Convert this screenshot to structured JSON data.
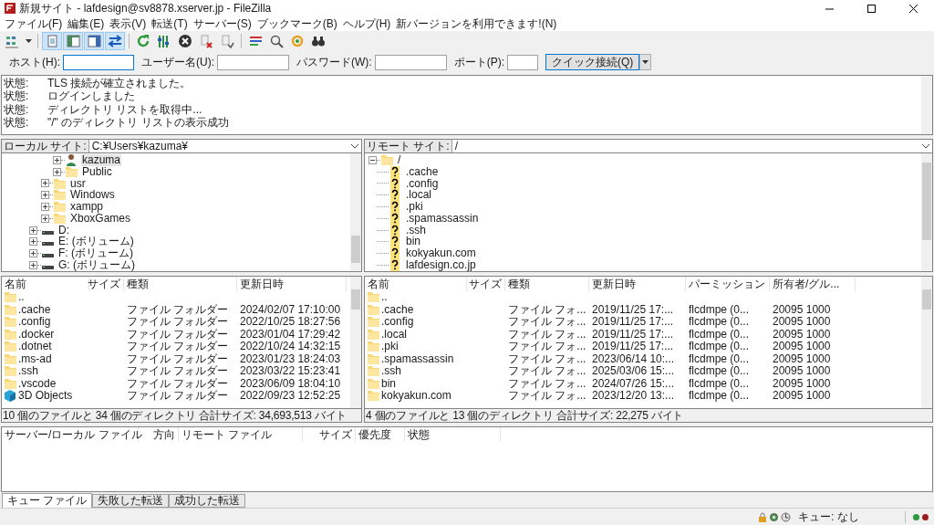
{
  "window": {
    "title": "新規サイト - lafdesign@sv8878.xserver.jp - FileZilla"
  },
  "menu": [
    "ファイル(F)",
    "編集(E)",
    "表示(V)",
    "転送(T)",
    "サーバー(S)",
    "ブックマーク(B)",
    "ヘルプ(H)",
    "新バージョンを利用できます!(N)"
  ],
  "toolbar": [
    {
      "kind": "sites",
      "pressed": false
    },
    {
      "kind": "caret",
      "pressed": false
    },
    {
      "kind": "sep"
    },
    {
      "kind": "log",
      "pressed": true
    },
    {
      "kind": "localtree",
      "pressed": true
    },
    {
      "kind": "remotetree",
      "pressed": true
    },
    {
      "kind": "queue",
      "pressed": true
    },
    {
      "kind": "sep"
    },
    {
      "kind": "refresh",
      "pressed": false
    },
    {
      "kind": "filter",
      "pressed": false
    },
    {
      "kind": "cancel",
      "pressed": false
    },
    {
      "kind": "disconnect",
      "pressed": false
    },
    {
      "kind": "reconnect",
      "pressed": false
    },
    {
      "kind": "sep"
    },
    {
      "kind": "compare",
      "pressed": false
    },
    {
      "kind": "search",
      "pressed": false
    },
    {
      "kind": "sync",
      "pressed": false
    },
    {
      "kind": "binoculars",
      "pressed": false
    }
  ],
  "quickconnect": {
    "host_label": "ホスト(H):",
    "user_label": "ユーザー名(U):",
    "password_label": "パスワード(W):",
    "port_label": "ポート(P):",
    "button": "クイック接続(Q)"
  },
  "log": [
    {
      "label": "状態:",
      "message": "TLS 接続が確立されました。"
    },
    {
      "label": "状態:",
      "message": "ログインしました"
    },
    {
      "label": "状態:",
      "message": "ディレクトリ リストを取得中..."
    },
    {
      "label": "状態:",
      "message": "\"/\" のディレクトリ リストの表示成功"
    }
  ],
  "local": {
    "site_label": "ローカル サイト:",
    "path": "C:¥Users¥kazuma¥",
    "tree": [
      {
        "children": [
          {
            "children": [
              {
                "label": "kazuma",
                "kind": "user",
                "expanded": false,
                "selected": true
              },
              {
                "label": "Public",
                "kind": "folder",
                "expanded": false,
                "selected": false
              }
            ]
          },
          {
            "label": "usr",
            "kind": "folder",
            "expanded": false,
            "selected": false
          },
          {
            "label": "Windows",
            "kind": "folder",
            "expanded": false,
            "selected": false
          },
          {
            "label": "xampp",
            "kind": "folder",
            "expanded": false,
            "selected": false
          },
          {
            "label": "XboxGames",
            "kind": "folder",
            "expanded": false,
            "selected": false
          }
        ]
      },
      {
        "label": "D:",
        "kind": "drive",
        "expanded": false,
        "selected": false
      },
      {
        "label": "E: (ボリューム)",
        "kind": "drive",
        "expanded": false,
        "selected": false
      },
      {
        "label": "F: (ボリューム)",
        "kind": "drive",
        "expanded": false,
        "selected": false
      },
      {
        "label": "G: (ボリューム)",
        "kind": "drive",
        "expanded": false,
        "selected": false
      }
    ],
    "columns": [
      "名前",
      "サイズ",
      "種類",
      "更新日時"
    ],
    "rows": [
      {
        "kind": "folder",
        "cells": [
          ".."
        ]
      },
      {
        "kind": "folder",
        "cells": [
          ".cache",
          "",
          "ファイル フォルダー",
          "2024/02/07 17:10:00"
        ]
      },
      {
        "kind": "folder",
        "cells": [
          ".config",
          "",
          "ファイル フォルダー",
          "2022/10/25 18:27:56"
        ]
      },
      {
        "kind": "folder",
        "cells": [
          ".docker",
          "",
          "ファイル フォルダー",
          "2023/01/04 17:29:42"
        ]
      },
      {
        "kind": "folder",
        "cells": [
          ".dotnet",
          "",
          "ファイル フォルダー",
          "2022/10/24 14:32:15"
        ]
      },
      {
        "kind": "folder",
        "cells": [
          ".ms-ad",
          "",
          "ファイル フォルダー",
          "2023/01/23 18:24:03"
        ]
      },
      {
        "kind": "folder",
        "cells": [
          ".ssh",
          "",
          "ファイル フォルダー",
          "2023/03/22 15:23:41"
        ]
      },
      {
        "kind": "folder",
        "cells": [
          ".vscode",
          "",
          "ファイル フォルダー",
          "2023/06/09 18:04:10"
        ]
      },
      {
        "kind": "cube",
        "cells": [
          "3D Objects",
          "",
          "ファイル フォルダー",
          "2022/09/23 12:52:25"
        ]
      }
    ],
    "status": "10 個のファイルと 34 個のディレクトリ 合計サイズ: 34,693,513 バイト"
  },
  "remote": {
    "site_label": "リモート サイト:",
    "path": "/",
    "tree": [
      {
        "label": "/",
        "kind": "folder",
        "expanded": true,
        "selected": false,
        "children": [
          {
            "label": ".cache",
            "kind": "unknown",
            "selected": false
          },
          {
            "label": ".config",
            "kind": "unknown",
            "selected": false
          },
          {
            "label": ".local",
            "kind": "unknown",
            "selected": false
          },
          {
            "label": ".pki",
            "kind": "unknown",
            "selected": false
          },
          {
            "label": ".spamassassin",
            "kind": "unknown",
            "selected": false
          },
          {
            "label": ".ssh",
            "kind": "unknown",
            "selected": false
          },
          {
            "label": "bin",
            "kind": "unknown",
            "selected": false
          },
          {
            "label": "kokyakun.com",
            "kind": "unknown",
            "selected": false
          },
          {
            "label": "lafdesign.co.jp",
            "kind": "unknown",
            "selected": false
          }
        ]
      }
    ],
    "columns": [
      "名前",
      "サイズ",
      "種類",
      "更新日時",
      "パーミッション",
      "所有者/グル..."
    ],
    "rows": [
      {
        "kind": "folder",
        "cells": [
          ".."
        ]
      },
      {
        "kind": "folder",
        "cells": [
          ".cache",
          "",
          "ファイル フォ...",
          "2019/11/25 17:...",
          "flcdmpe (0...",
          "20095 1000"
        ]
      },
      {
        "kind": "folder",
        "cells": [
          ".config",
          "",
          "ファイル フォ...",
          "2019/11/25 17:...",
          "flcdmpe (0...",
          "20095 1000"
        ]
      },
      {
        "kind": "folder",
        "cells": [
          ".local",
          "",
          "ファイル フォ...",
          "2019/11/25 17:...",
          "flcdmpe (0...",
          "20095 1000"
        ]
      },
      {
        "kind": "folder",
        "cells": [
          ".pki",
          "",
          "ファイル フォ...",
          "2019/11/25 17:...",
          "flcdmpe (0...",
          "20095 1000"
        ]
      },
      {
        "kind": "folder",
        "cells": [
          ".spamassassin",
          "",
          "ファイル フォ...",
          "2023/06/14 10:...",
          "flcdmpe (0...",
          "20095 1000"
        ]
      },
      {
        "kind": "folder",
        "cells": [
          ".ssh",
          "",
          "ファイル フォ...",
          "2025/03/06 15:...",
          "flcdmpe (0...",
          "20095 1000"
        ]
      },
      {
        "kind": "folder",
        "cells": [
          "bin",
          "",
          "ファイル フォ...",
          "2024/07/26 15:...",
          "flcdmpe (0...",
          "20095 1000"
        ]
      },
      {
        "kind": "folder",
        "cells": [
          "kokyakun.com",
          "",
          "ファイル フォ...",
          "2023/12/20 13:...",
          "flcdmpe (0...",
          "20095 1000"
        ]
      }
    ],
    "status": "4 個のファイルと 13 個のディレクトリ 合計サイズ: 22,275 バイト"
  },
  "queue": {
    "columns": [
      "サーバー/ローカル ファイル",
      "方向",
      "リモート ファイル",
      "サイズ",
      "優先度",
      "状態"
    ]
  },
  "tabs": [
    {
      "label": "キュー ファイル",
      "selected": true
    },
    {
      "label": "失敗した転送",
      "selected": false
    },
    {
      "label": "成功した転送",
      "selected": false
    }
  ],
  "status_bar": {
    "queue": "キュー: なし",
    "lights": [
      {
        "color": "#2f9a3a"
      },
      {
        "color": "#9a1c1c"
      }
    ]
  }
}
